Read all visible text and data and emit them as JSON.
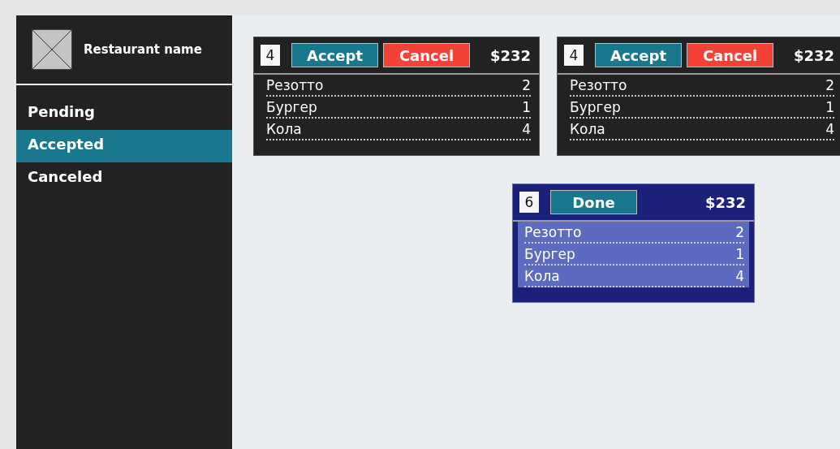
{
  "sidebar": {
    "restaurant_name": "Restaurant name",
    "items": [
      {
        "label": "Pending",
        "selected": false
      },
      {
        "label": "Accepted",
        "selected": true
      },
      {
        "label": "Canceled",
        "selected": false
      }
    ]
  },
  "orders": [
    {
      "kind": "pending",
      "number": "4",
      "buttons": [
        {
          "label": "Accept",
          "kind": "accept"
        },
        {
          "label": "Cancel",
          "kind": "cancel"
        }
      ],
      "total": "$232",
      "items": [
        {
          "name": "Резотто",
          "qty": "2"
        },
        {
          "name": "Бургер",
          "qty": "1"
        },
        {
          "name": "Кола",
          "qty": "4"
        }
      ]
    },
    {
      "kind": "pending",
      "number": "4",
      "buttons": [
        {
          "label": "Accept",
          "kind": "accept"
        },
        {
          "label": "Cancel",
          "kind": "cancel"
        }
      ],
      "total": "$232",
      "items": [
        {
          "name": "Резотто",
          "qty": "2"
        },
        {
          "name": "Бургер",
          "qty": "1"
        },
        {
          "name": "Кола",
          "qty": "4"
        }
      ]
    },
    {
      "kind": "accepted",
      "number": "6",
      "buttons": [
        {
          "label": "Done",
          "kind": "accept"
        }
      ],
      "total": "$232",
      "items": [
        {
          "name": "Резотто",
          "qty": "2"
        },
        {
          "name": "Бургер",
          "qty": "1"
        },
        {
          "name": "Кола",
          "qty": "4"
        }
      ]
    }
  ]
}
